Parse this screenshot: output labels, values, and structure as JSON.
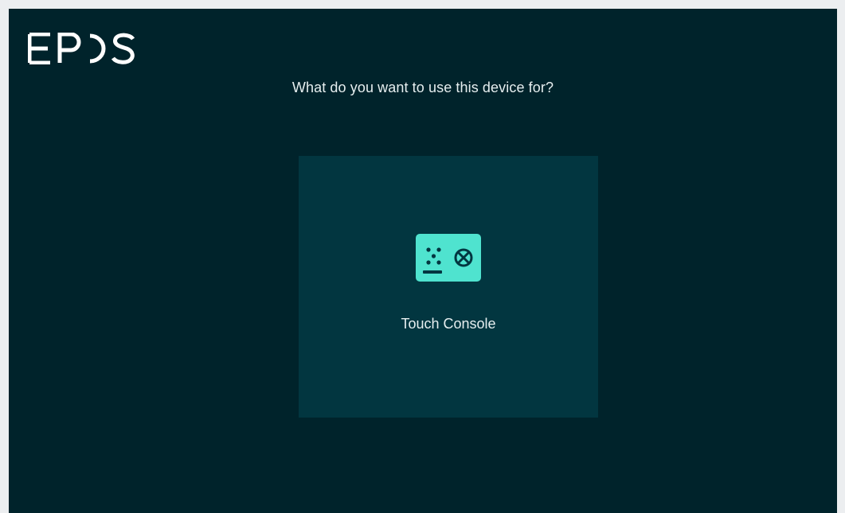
{
  "brand": {
    "logo_text": "EPOS"
  },
  "setup": {
    "prompt": "What do you want to use this device for?",
    "options": [
      {
        "label": "Touch Console",
        "icon": "touch-console-icon"
      }
    ]
  },
  "colors": {
    "background": "#00232b",
    "card_background": "#023640",
    "icon_accent": "#4fe3cf",
    "text": "#e6eeef",
    "outer_frame": "#eceef0"
  }
}
